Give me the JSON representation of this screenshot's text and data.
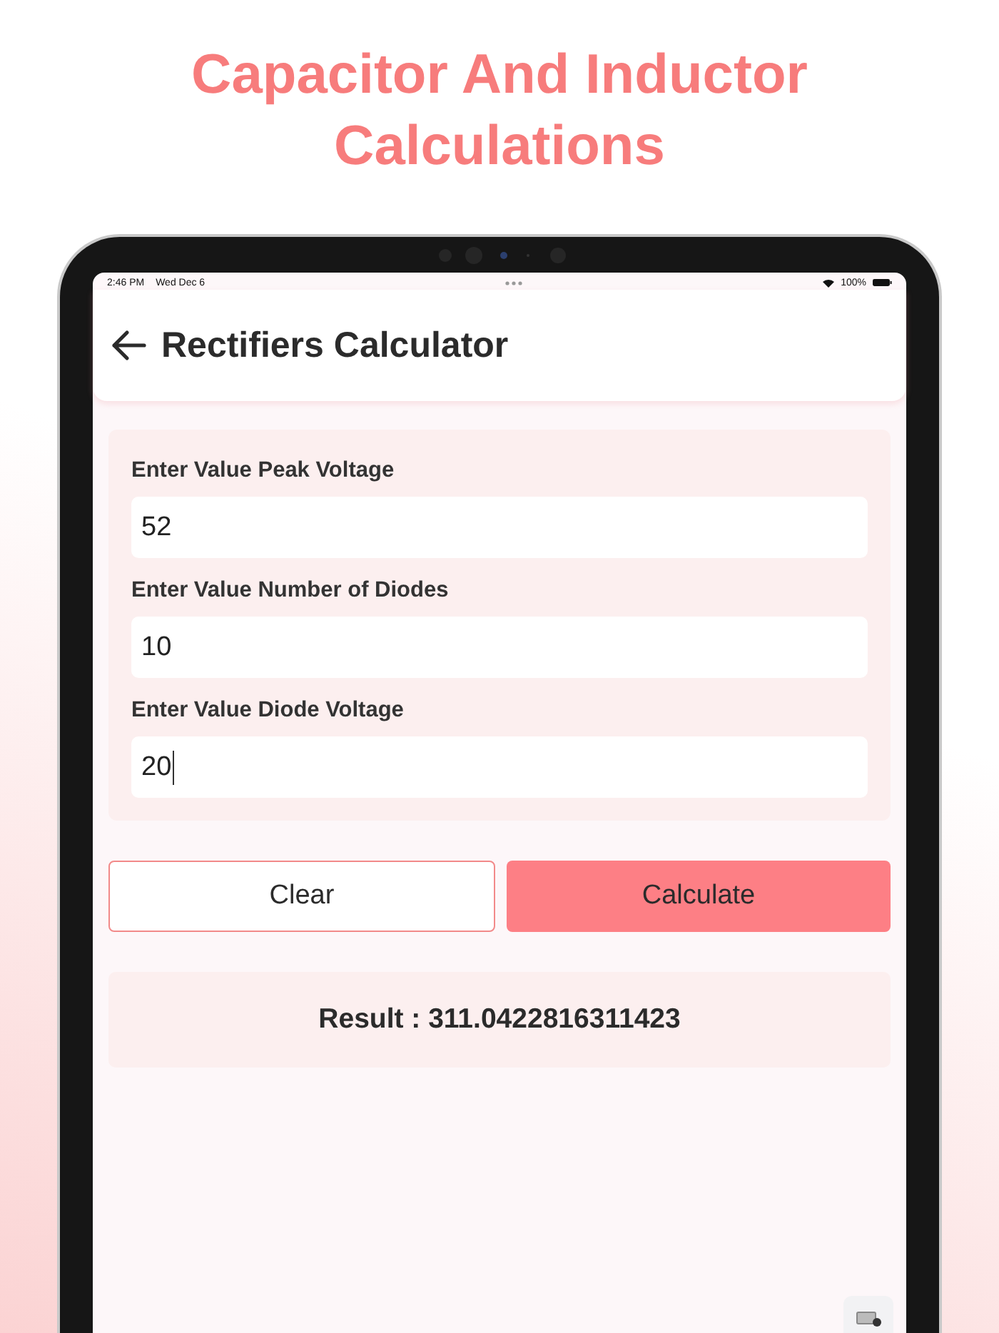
{
  "headline": "Capacitor And Inductor Calculations",
  "status_bar": {
    "time": "2:46 PM",
    "date": "Wed Dec 6",
    "battery": "100%"
  },
  "header": {
    "title": "Rectifiers Calculator"
  },
  "fields": [
    {
      "label": "Enter Value Peak Voltage",
      "value": "52",
      "focused": false
    },
    {
      "label": "Enter Value Number of Diodes",
      "value": "10",
      "focused": false
    },
    {
      "label": "Enter Value Diode Voltage",
      "value": "20",
      "focused": true
    }
  ],
  "buttons": [
    {
      "label": "Clear",
      "kind": "outline"
    },
    {
      "label": "Calculate",
      "kind": "filled"
    }
  ],
  "result": "Result : 311.0422816311423"
}
